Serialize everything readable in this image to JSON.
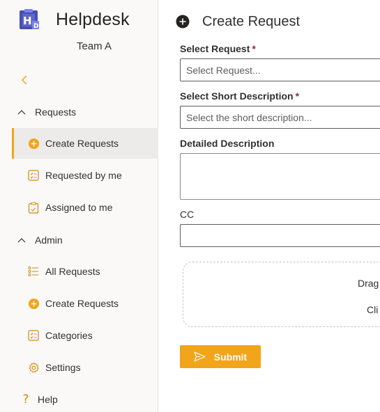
{
  "app": {
    "title": "Helpdesk",
    "team": "Team A"
  },
  "sidebar": {
    "sections": [
      {
        "label": "Requests"
      },
      {
        "label": "Admin"
      }
    ],
    "items": [
      {
        "label": "Create Requests",
        "icon": "plus-circle-icon",
        "active": true
      },
      {
        "label": "Requested by me",
        "icon": "checklist-icon"
      },
      {
        "label": "Assigned to me",
        "icon": "clipboard-icon"
      },
      {
        "label": "All Requests",
        "icon": "bullet-list-icon"
      },
      {
        "label": "Create Requests",
        "icon": "plus-circle-icon"
      },
      {
        "label": "Categories",
        "icon": "checklist-icon"
      },
      {
        "label": "Settings",
        "icon": "gear-icon"
      },
      {
        "label": "Help",
        "icon": "question-icon"
      }
    ]
  },
  "form": {
    "title": "Create Request",
    "request": {
      "label": "Select Request",
      "required_mark": "*",
      "placeholder": "Select Request..."
    },
    "short_description": {
      "label": "Select Short Description",
      "required_mark": "*",
      "placeholder": "Select the short description..."
    },
    "detailed_description": {
      "label": "Detailed Description",
      "value": ""
    },
    "cc": {
      "label": "CC",
      "value": ""
    },
    "dropzone": {
      "line1": "Drag",
      "line2": "Cli"
    },
    "submit_label": "Submit"
  },
  "colors": {
    "accent": "#f2a41b",
    "required": "#a4262c",
    "sidebar_bg": "#faf9f8",
    "active_bg": "#edebe9"
  }
}
